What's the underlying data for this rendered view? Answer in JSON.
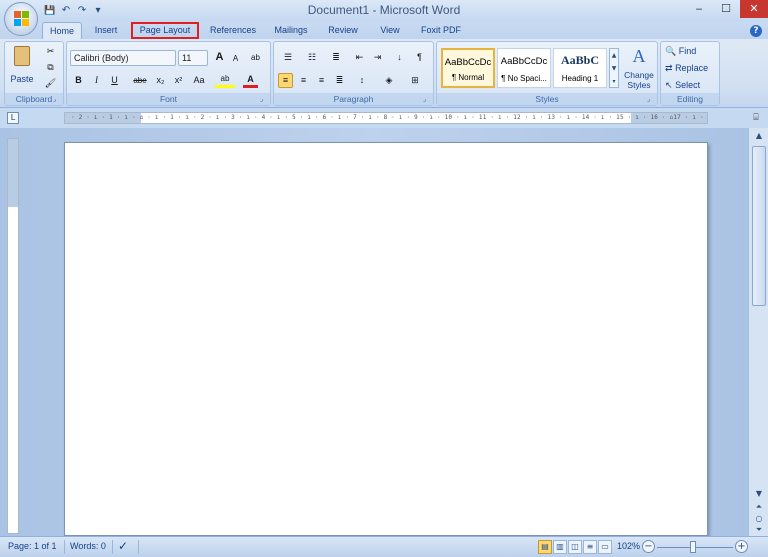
{
  "window": {
    "title": "Document1 - Microsoft Word",
    "minimize": "‒",
    "maximize": "☐",
    "close": "✕"
  },
  "qat": {
    "save": "💾",
    "undo": "↶",
    "redo": "↷",
    "more": "▾"
  },
  "tabs": [
    {
      "label": "Home",
      "active": true
    },
    {
      "label": "Insert"
    },
    {
      "label": "Page Layout",
      "highlighted": true
    },
    {
      "label": "References"
    },
    {
      "label": "Mailings"
    },
    {
      "label": "Review"
    },
    {
      "label": "View"
    },
    {
      "label": "Foxit PDF"
    }
  ],
  "groups": {
    "clipboard": {
      "label": "Clipboard",
      "paste": "Paste"
    },
    "font": {
      "label": "Font",
      "font_name": "Calibri (Body)",
      "font_size": "11",
      "bold": "B",
      "italic": "I",
      "underline": "U",
      "strike": "abe",
      "sub": "x₂",
      "sup": "x²",
      "case": "Aa",
      "grow": "A",
      "shrink": "A",
      "clear": "ab",
      "highlight": "ab",
      "color": "A"
    },
    "paragraph": {
      "label": "Paragraph"
    },
    "styles": {
      "label": "Styles",
      "items": [
        {
          "sample": "AaBbCcDc",
          "name": "¶ Normal"
        },
        {
          "sample": "AaBbCcDc",
          "name": "¶ No Spaci..."
        },
        {
          "sample": "AaBbC",
          "name": "Heading 1"
        }
      ],
      "change_styles": "Change Styles"
    },
    "editing": {
      "label": "Editing",
      "find": "Find",
      "replace": "Replace",
      "select": "Select"
    }
  },
  "ruler": {
    "ticks": "· 2 · ı · 1 · ı · ⌂ · ı · 1 · ı · 2 · ı · 3 · ı · 4 · ı · 5 · ı · 6 · ı · 7 · ı · 8 · ı · 9 · ı · 10 · ı · 11 · ı · 12 · ı · 13 · ı · 14 · ı · 15 · ı · 16 · ⌂17 · ı · 18 · ı · 19",
    "corner": "L"
  },
  "status": {
    "page": "Page: 1 of 1",
    "words": "Words: 0",
    "zoom": "102%",
    "zoom_minus": "−",
    "zoom_plus": "+"
  },
  "colors": {
    "accent": "#15428b",
    "close": "#c7372f",
    "highlight": "#e02020"
  }
}
